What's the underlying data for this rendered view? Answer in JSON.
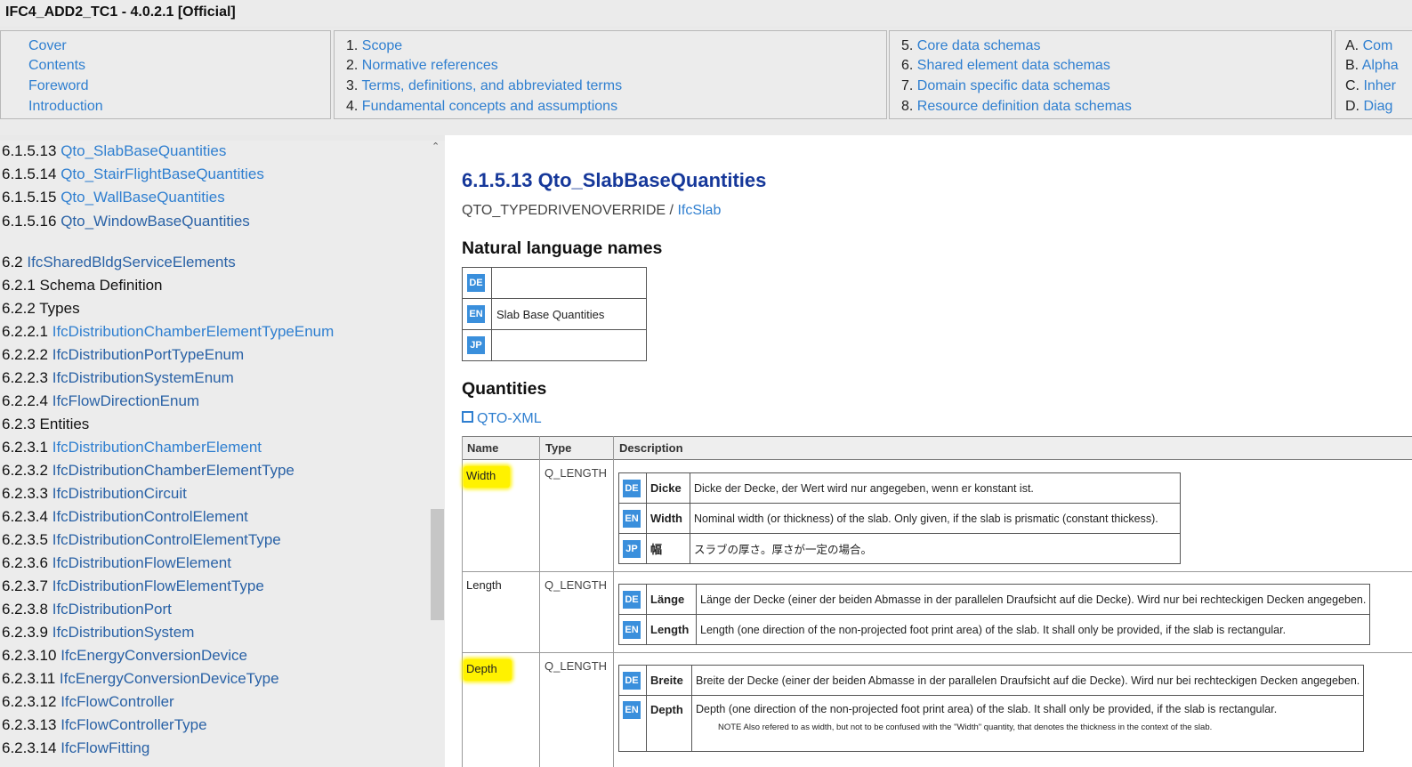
{
  "window_title": "IFC4_ADD2_TC1 - 4.0.2.1 [Official]",
  "topnav": {
    "col1": [
      "Cover",
      "Contents",
      "Foreword",
      "Introduction"
    ],
    "col2": [
      {
        "num": "1.",
        "label": "Scope"
      },
      {
        "num": "2.",
        "label": "Normative references"
      },
      {
        "num": "3.",
        "label": "Terms, definitions, and abbreviated terms"
      },
      {
        "num": "4.",
        "label": "Fundamental concepts and assumptions"
      }
    ],
    "col3": [
      {
        "num": "5.",
        "label": "Core data schemas"
      },
      {
        "num": "6.",
        "label": "Shared element data schemas"
      },
      {
        "num": "7.",
        "label": "Domain specific data schemas"
      },
      {
        "num": "8.",
        "label": "Resource definition data schemas"
      }
    ],
    "col4": [
      {
        "num": "A.",
        "label": "Com"
      },
      {
        "num": "B.",
        "label": "Alpha"
      },
      {
        "num": "C.",
        "label": "Inher"
      },
      {
        "num": "D.",
        "label": "Diag"
      }
    ]
  },
  "sidebar": {
    "scroll_up_glyph": "⌃",
    "items": [
      {
        "num": "6.1.5.13",
        "label": "Qto_SlabBaseQuantities",
        "link": "light"
      },
      {
        "num": "6.1.5.14",
        "label": "Qto_StairFlightBaseQuantities",
        "link": "light"
      },
      {
        "num": "6.1.5.15",
        "label": "Qto_WallBaseQuantities",
        "link": "light"
      },
      {
        "num": "6.1.5.16",
        "label": "Qto_WindowBaseQuantities",
        "link": "dark"
      },
      {
        "num": "6.2",
        "label": "IfcSharedBldgServiceElements",
        "link": "dark"
      },
      {
        "num": "6.2.1",
        "label": "Schema Definition",
        "link": "none"
      },
      {
        "num": "6.2.2",
        "label": "Types",
        "link": "none"
      },
      {
        "num": "6.2.2.1",
        "label": "IfcDistributionChamberElementTypeEnum",
        "link": "light"
      },
      {
        "num": "6.2.2.2",
        "label": "IfcDistributionPortTypeEnum",
        "link": "dark"
      },
      {
        "num": "6.2.2.3",
        "label": "IfcDistributionSystemEnum",
        "link": "dark"
      },
      {
        "num": "6.2.2.4",
        "label": "IfcFlowDirectionEnum",
        "link": "dark"
      },
      {
        "num": "6.2.3",
        "label": "Entities",
        "link": "none"
      },
      {
        "num": "6.2.3.1",
        "label": "IfcDistributionChamberElement",
        "link": "light"
      },
      {
        "num": "6.2.3.2",
        "label": "IfcDistributionChamberElementType",
        "link": "dark"
      },
      {
        "num": "6.2.3.3",
        "label": "IfcDistributionCircuit",
        "link": "dark"
      },
      {
        "num": "6.2.3.4",
        "label": "IfcDistributionControlElement",
        "link": "dark"
      },
      {
        "num": "6.2.3.5",
        "label": "IfcDistributionControlElementType",
        "link": "dark"
      },
      {
        "num": "6.2.3.6",
        "label": "IfcDistributionFlowElement",
        "link": "dark"
      },
      {
        "num": "6.2.3.7",
        "label": "IfcDistributionFlowElementType",
        "link": "dark"
      },
      {
        "num": "6.2.3.8",
        "label": "IfcDistributionPort",
        "link": "dark"
      },
      {
        "num": "6.2.3.9",
        "label": "IfcDistributionSystem",
        "link": "dark"
      },
      {
        "num": "6.2.3.10",
        "label": "IfcEnergyConversionDevice",
        "link": "dark"
      },
      {
        "num": "6.2.3.11",
        "label": "IfcEnergyConversionDeviceType",
        "link": "dark"
      },
      {
        "num": "6.2.3.12",
        "label": "IfcFlowController",
        "link": "dark"
      },
      {
        "num": "6.2.3.13",
        "label": "IfcFlowControllerType",
        "link": "dark"
      },
      {
        "num": "6.2.3.14",
        "label": "IfcFlowFitting",
        "link": "dark"
      }
    ]
  },
  "main": {
    "title": "6.1.5.13 Qto_SlabBaseQuantities",
    "subtitle_prefix": "QTO_TYPEDRIVENOVERRIDE",
    "subtitle_sep": " / ",
    "subtitle_link": "IfcSlab",
    "natural_names_heading": "Natural language names",
    "natural_names": [
      {
        "lang": "DE",
        "value": ""
      },
      {
        "lang": "EN",
        "value": "Slab Base Quantities"
      },
      {
        "lang": "JP",
        "value": ""
      }
    ],
    "quantities_heading": "Quantities",
    "qto_xml_link": "QTO-XML",
    "table_headers": {
      "name": "Name",
      "type": "Type",
      "description": "Description"
    },
    "quantities": [
      {
        "name": "Width",
        "highlighted": true,
        "type": "Q_LENGTH",
        "desc": [
          {
            "lang": "DE",
            "word": "Dicke",
            "text": "Dicke der Decke, der Wert wird nur angegeben, wenn er konstant ist."
          },
          {
            "lang": "EN",
            "word": "Width",
            "text": "Nominal width (or thickness) of the slab. Only given, if the slab is prismatic (constant thickess)."
          },
          {
            "lang": "JP",
            "word": "幅",
            "text": "スラブの厚さ。厚さが一定の場合。"
          }
        ]
      },
      {
        "name": "Length",
        "highlighted": false,
        "type": "Q_LENGTH",
        "desc": [
          {
            "lang": "DE",
            "word": "Länge",
            "text": "Länge der Decke (einer der beiden Abmasse in der parallelen Draufsicht auf die Decke). Wird nur bei rechteckigen Decken angegeben."
          },
          {
            "lang": "EN",
            "word": "Length",
            "text": "Length (one direction of the non-projected foot print area) of the slab. It shall only be provided, if the slab is rectangular."
          }
        ]
      },
      {
        "name": "Depth",
        "highlighted": true,
        "type": "Q_LENGTH",
        "desc": [
          {
            "lang": "DE",
            "word": "Breite",
            "text": "Breite der Decke (einer der beiden Abmasse in der parallelen Draufsicht auf die Decke). Wird nur bei rechteckigen Decken angegeben."
          },
          {
            "lang": "EN",
            "word": "Depth",
            "text": "Depth (one direction of the non-projected foot print area) of the slab. It shall only be provided, if the slab is rectangular.",
            "note": "NOTE  Also refered to as width, but not to be confused with the \"Width\" quantity, that denotes the thickness in the context of the slab."
          }
        ]
      }
    ]
  }
}
